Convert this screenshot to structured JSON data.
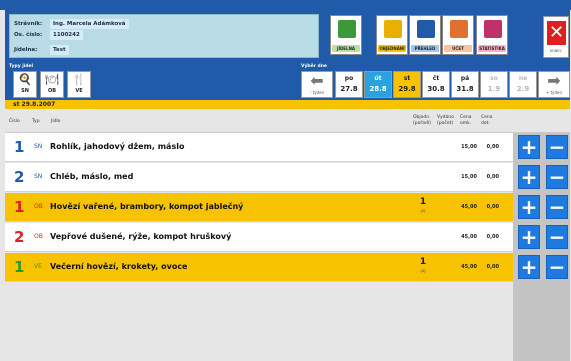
{
  "header": {
    "stravnik_label": "Strávník:",
    "stravnik_value": "Ing. Marcela Adámková",
    "cislo_label": "Os. číslo:",
    "cislo_value": "1100242",
    "jidelna_label": "Jídelna:",
    "jidelna_value": "Test"
  },
  "nav": [
    {
      "label": "JÍDELNA",
      "icon": "canteen-icon",
      "color": "#3a9a3a",
      "bg": "#b8e0a0"
    },
    {
      "label": "OBJEDNÁNÍ",
      "icon": "order-icon",
      "color": "#e8b000",
      "bg": "#f7c300"
    },
    {
      "label": "PŘEHLED",
      "icon": "overview-icon",
      "color": "#1f5ba8",
      "bg": "#9ec6ec"
    },
    {
      "label": "ÚČET",
      "icon": "account-icon",
      "color": "#e07030",
      "bg": "#f6c4a4"
    },
    {
      "label": "STATISTIKA",
      "icon": "statistics-icon",
      "color": "#c0306a",
      "bg": "#f4b0cc"
    }
  ],
  "close_label": "KONEC",
  "toolbar": {
    "types_label": "Typy jídel",
    "types": [
      "SN",
      "OB",
      "VE"
    ],
    "days_label": "Výběr dne",
    "prev_label": "- týden",
    "next_label": "+ týden",
    "days": [
      {
        "d": "po",
        "n": "27.8",
        "state": "normal"
      },
      {
        "d": "út",
        "n": "28.8",
        "state": "blue"
      },
      {
        "d": "st",
        "n": "29.8",
        "state": "yellow"
      },
      {
        "d": "čt",
        "n": "30.8",
        "state": "normal"
      },
      {
        "d": "pá",
        "n": "31.8",
        "state": "normal"
      },
      {
        "d": "so",
        "n": "1.9",
        "state": "disabled"
      },
      {
        "d": "ne",
        "n": "2.9",
        "state": "disabled"
      }
    ]
  },
  "date_bar": "st 29.8.2007",
  "columns": {
    "cislo": "Číslo",
    "typ": "Typ",
    "jidlo": "Jídlo",
    "obj": "Objedn. (pořadí)",
    "vyd": "Vydáno (počet)",
    "cena_omk": "Cena omk.",
    "cena_dot": "Cena dot."
  },
  "rows": [
    {
      "cislo": "1",
      "typ": "SN",
      "jidlo": "Rohlík, jahodový džem, máslo",
      "obj": "",
      "obj_sub": "",
      "cena": "15,00",
      "dot": "0,00",
      "bg": "white",
      "num_color": "#1f5ba8",
      "typ_color": "#1f5ba8"
    },
    {
      "cislo": "2",
      "typ": "SN",
      "jidlo": "Chléb, máslo, med",
      "obj": "",
      "obj_sub": "",
      "cena": "15,00",
      "dot": "0,00",
      "bg": "white",
      "num_color": "#1f5ba8",
      "typ_color": "#1f5ba8"
    },
    {
      "cislo": "1",
      "typ": "OB",
      "jidlo": "Hovězí vařené, brambory, kompot jablečný",
      "obj": "1",
      "obj_sub": "(1)",
      "cena": "45,00",
      "dot": "0,00",
      "bg": "yellow",
      "num_color": "#e02020",
      "typ_color": "#e02020"
    },
    {
      "cislo": "2",
      "typ": "OB",
      "jidlo": "Vepřové dušené, rýže, kompot hruškový",
      "obj": "",
      "obj_sub": "",
      "cena": "45,00",
      "dot": "0,00",
      "bg": "white",
      "num_color": "#e02020",
      "typ_color": "#e02020"
    },
    {
      "cislo": "1",
      "typ": "VE",
      "jidlo": "Večerní hovězí, krokety, ovoce",
      "obj": "1",
      "obj_sub": "(1)",
      "cena": "45,00",
      "dot": "0,00",
      "bg": "yellow",
      "num_color": "#2a9a2a",
      "typ_color": "#2a9a2a"
    }
  ]
}
